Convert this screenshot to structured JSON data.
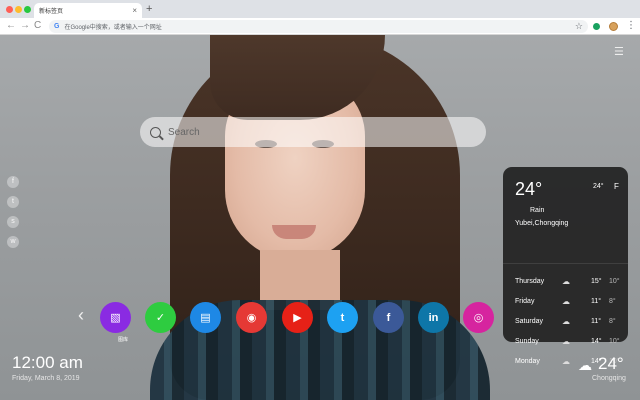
{
  "browser": {
    "tab_title": "新标签页",
    "tab_close": "×",
    "new_tab": "+",
    "back": "←",
    "forward": "→",
    "reload": "C",
    "omnibox_placeholder": "在Google中搜索，或者输入一个网址",
    "google_letter": "G",
    "bookmark_star": "☆",
    "menu_dots": "⋮"
  },
  "page": {
    "menu_icon": "☰",
    "search": {
      "placeholder": "Search"
    },
    "social": [
      {
        "name": "facebook-icon",
        "glyph": "f"
      },
      {
        "name": "twitter-icon",
        "glyph": "t"
      },
      {
        "name": "snapchat-icon",
        "glyph": "s"
      },
      {
        "name": "wechat-icon",
        "glyph": "w"
      }
    ],
    "shortcuts": {
      "prev_arrow": "‹",
      "items": [
        {
          "label": "图库",
          "icon": "gallery-icon",
          "color": "#8a2be2",
          "glyph": "▧"
        },
        {
          "label": "",
          "icon": "check-icon",
          "color": "#2ecc40",
          "glyph": "✓"
        },
        {
          "label": "",
          "icon": "note-icon",
          "color": "#1e88e5",
          "glyph": "▤"
        },
        {
          "label": "",
          "icon": "game-icon",
          "color": "#e53935",
          "glyph": "◉"
        },
        {
          "label": "",
          "icon": "youtube-icon",
          "color": "#e62117",
          "glyph": "▶"
        },
        {
          "label": "",
          "icon": "twitter-icon",
          "color": "#1da1f2",
          "glyph": "t"
        },
        {
          "label": "",
          "icon": "facebook-icon",
          "color": "#3b5998",
          "glyph": "f"
        },
        {
          "label": "",
          "icon": "linkedin-icon",
          "color": "#0e76a8",
          "glyph": "in"
        },
        {
          "label": "",
          "icon": "instagram-icon",
          "color": "#d6249f",
          "glyph": "◎"
        }
      ]
    },
    "weather_panel": {
      "temp": "24°",
      "mini_temp": "24°",
      "mini_unit": "F",
      "condition": "Rain",
      "location": "Yubei,Chongqing",
      "forecast": [
        {
          "day": "Thursday",
          "hi": "15°",
          "lo": "10°"
        },
        {
          "day": "Friday",
          "hi": "11°",
          "lo": "8°"
        },
        {
          "day": "Saturday",
          "hi": "11°",
          "lo": "8°"
        },
        {
          "day": "Sunday",
          "hi": "14°",
          "lo": "10°"
        },
        {
          "day": "Monday",
          "hi": "14°",
          "lo": "10°"
        }
      ]
    },
    "clock": {
      "time": "12:00 am",
      "date": "Friday, March 8, 2019"
    },
    "bottom_weather": {
      "temp": "24°",
      "city": "Chongqing"
    }
  }
}
